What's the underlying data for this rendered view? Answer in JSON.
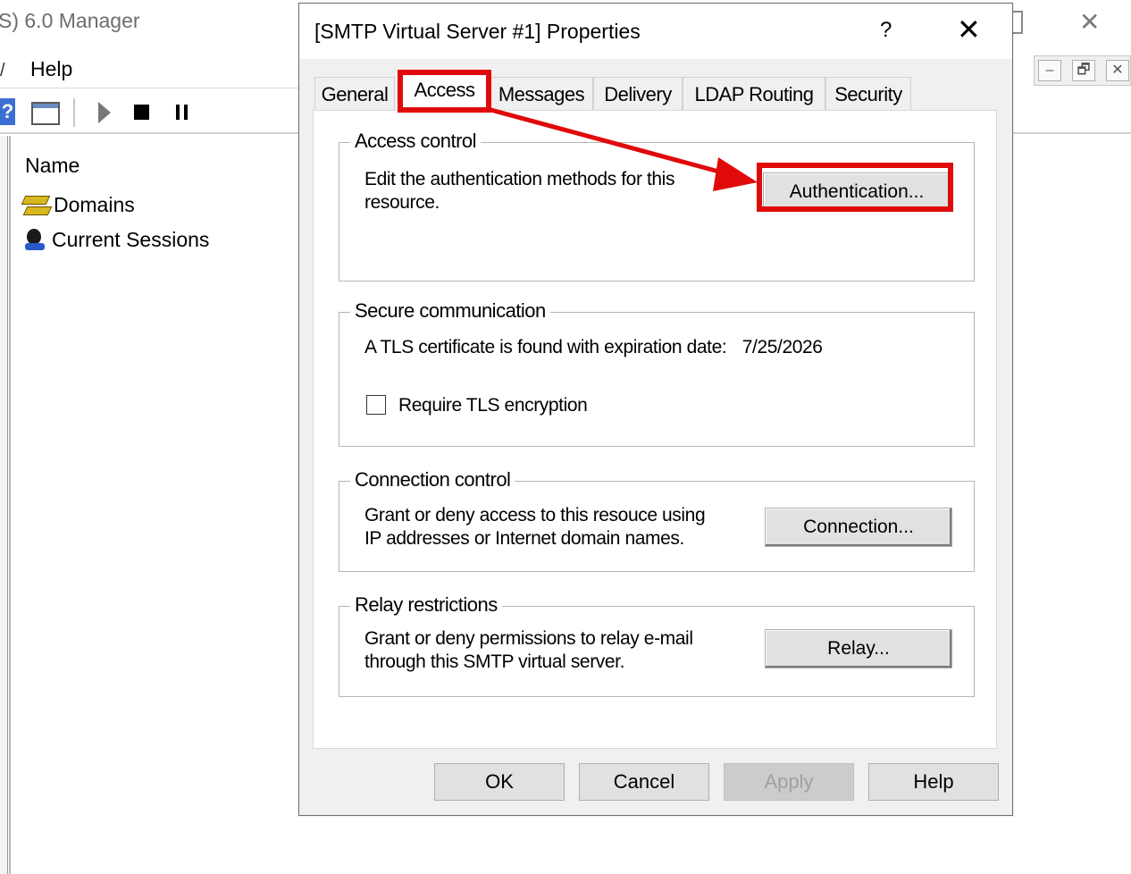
{
  "background_app": {
    "title_fragment": "S) 6.0 Manager",
    "menu_arrow": "/",
    "menu_help": "Help",
    "column_name": "Name",
    "tree_items": [
      {
        "label": "Domains",
        "icon": "domains-icon"
      },
      {
        "label": "Current Sessions",
        "icon": "current-sessions-icon"
      }
    ],
    "mdi": {
      "minimize": "–",
      "restore": "🗗",
      "close": "✕"
    },
    "close_glyph": "✕",
    "toolbar_help": "?"
  },
  "dialog": {
    "title": "[SMTP Virtual Server #1] Properties",
    "help_glyph": "?",
    "close_glyph": "✕",
    "tabs": [
      {
        "label": "General"
      },
      {
        "label": "Access",
        "active": true
      },
      {
        "label": "Messages"
      },
      {
        "label": "Delivery"
      },
      {
        "label": "LDAP Routing"
      },
      {
        "label": "Security"
      }
    ],
    "access_control": {
      "legend": "Access control",
      "description_line1": "Edit the authentication methods for this",
      "description_line2": "resource.",
      "button": "Authentication..."
    },
    "secure_communication": {
      "legend": "Secure communication",
      "certificate_text": "A TLS certificate is found with expiration date:",
      "expiration_date": "7/25/2026",
      "require_tls_label": "Require TLS encryption",
      "require_tls_checked": false
    },
    "connection_control": {
      "legend": "Connection control",
      "description_line1": "Grant or deny access to this resouce using",
      "description_line2": "IP addresses or Internet domain names.",
      "button": "Connection..."
    },
    "relay_restrictions": {
      "legend": "Relay restrictions",
      "description_line1": "Grant or deny permissions to relay e-mail",
      "description_line2": "through this SMTP virtual server.",
      "button": "Relay..."
    },
    "footer": {
      "ok": "OK",
      "cancel": "Cancel",
      "apply": "Apply",
      "help": "Help"
    }
  },
  "annotation": {
    "highlight_color": "#e10a0a"
  }
}
